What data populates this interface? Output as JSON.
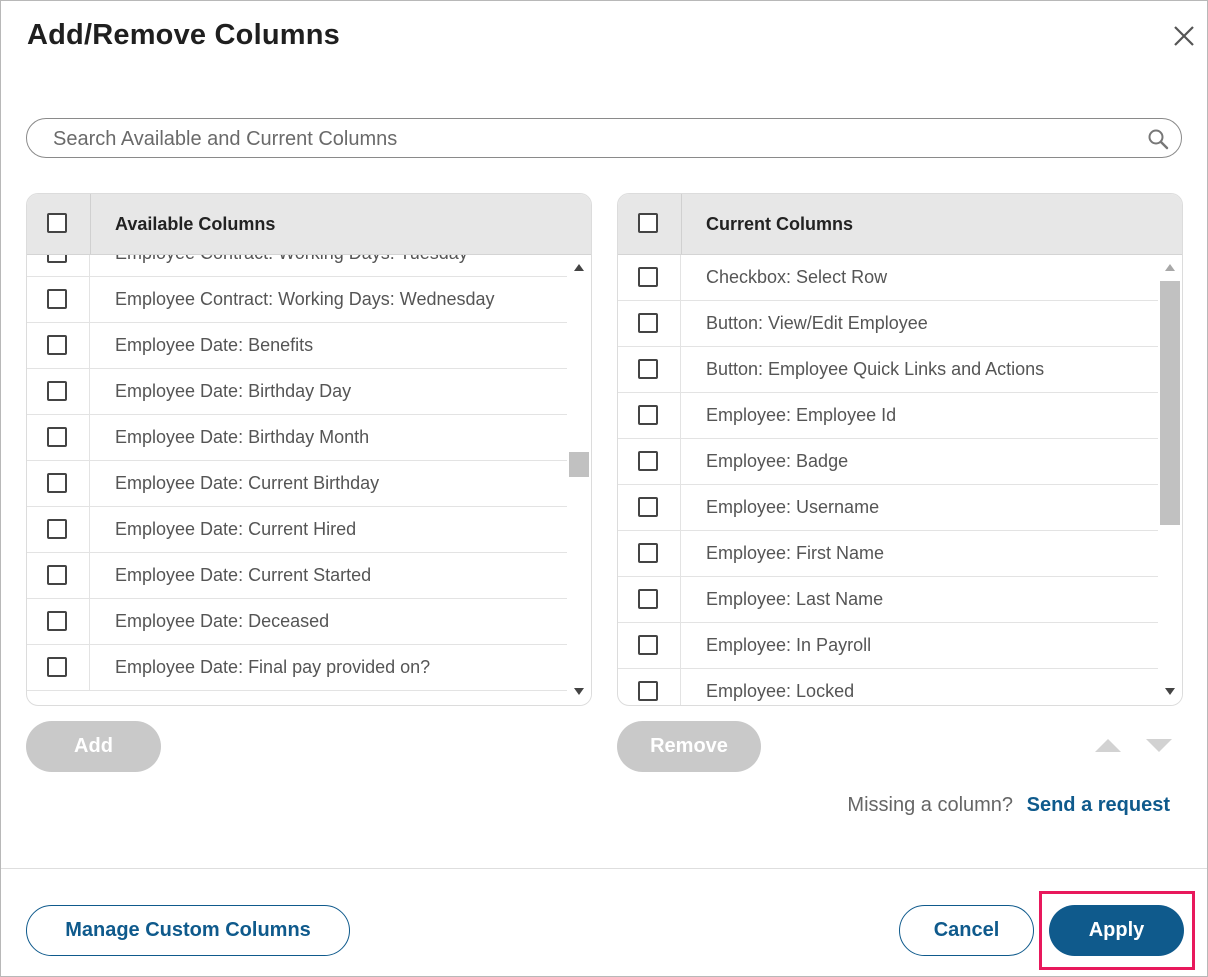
{
  "dialog": {
    "title": "Add/Remove Columns",
    "close_icon": "close-icon"
  },
  "search": {
    "placeholder": "Search Available and Current Columns",
    "value": "",
    "icon": "search-icon"
  },
  "available": {
    "header": "Available Columns",
    "items": [
      "Employee Contract: Working Days: Tuesday",
      "Employee Contract: Working Days: Wednesday",
      "Employee Date: Benefits",
      "Employee Date: Birthday Day",
      "Employee Date: Birthday Month",
      "Employee Date: Current Birthday",
      "Employee Date: Current Hired",
      "Employee Date: Current Started",
      "Employee Date: Deceased",
      "Employee Date: Final pay provided on?"
    ]
  },
  "current": {
    "header": "Current Columns",
    "items": [
      "Checkbox: Select Row",
      "Button: View/Edit Employee",
      "Button: Employee Quick Links and Actions",
      "Employee: Employee Id",
      "Employee: Badge",
      "Employee: Username",
      "Employee: First Name",
      "Employee: Last Name",
      "Employee: In Payroll",
      "Employee: Locked"
    ]
  },
  "actions": {
    "add_label": "Add",
    "remove_label": "Remove",
    "missing_text": "Missing a column?",
    "send_request_label": "Send a request"
  },
  "footer": {
    "manage_label": "Manage Custom Columns",
    "cancel_label": "Cancel",
    "apply_label": "Apply"
  },
  "colors": {
    "primary": "#0f5a8c",
    "disabled_button": "#c9c9c9",
    "highlight": "#e8185c",
    "header_bg": "#e7e7e7"
  }
}
